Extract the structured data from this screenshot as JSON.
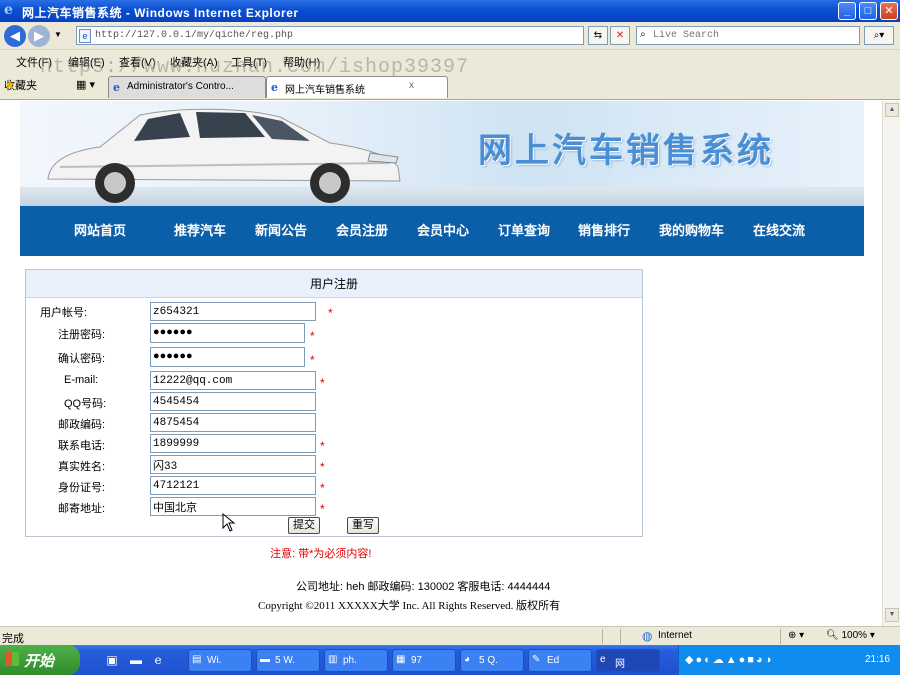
{
  "window": {
    "title": "网上汽车销售系统 - Windows Internet Explorer",
    "minimize": "_",
    "maximize": "□",
    "close": "✕"
  },
  "address": {
    "url": "http://127.0.0.1/my/qiche/reg.php",
    "search_placeholder": "Live Search"
  },
  "menu": [
    "文件(F)",
    "编辑(E)",
    "查看(V)",
    "收藏夹(A)",
    "工具(T)",
    "帮助(H)"
  ],
  "watermark": "https://www.huzhan.com/ishop39397",
  "favorites_label": "收藏夹",
  "tabs": [
    {
      "label": "Administrator's Contro..."
    },
    {
      "label": "网上汽车销售系统"
    }
  ],
  "site": {
    "title": "网上汽车销售系统",
    "nav": [
      "网站首页",
      "推荐汽车",
      "新闻公告",
      "会员注册",
      "会员中心",
      "订单查询",
      "销售排行",
      "我的购物车",
      "在线交流"
    ]
  },
  "form": {
    "heading": "用户注册",
    "fields": [
      {
        "label": "用户帐号:",
        "value": "z654321",
        "required": true
      },
      {
        "label": "注册密码:",
        "value": "●●●●●●",
        "required": true
      },
      {
        "label": "确认密码:",
        "value": "●●●●●●",
        "required": true
      },
      {
        "label": "E-mail:",
        "value": "12222@qq.com",
        "required": true
      },
      {
        "label": "QQ号码:",
        "value": "4545454",
        "required": false
      },
      {
        "label": "邮政编码:",
        "value": "4875454",
        "required": false
      },
      {
        "label": "联系电话:",
        "value": "1899999",
        "required": true
      },
      {
        "label": "真实姓名:",
        "value": "闪33",
        "required": true
      },
      {
        "label": "身份证号:",
        "value": "4712121",
        "required": true
      },
      {
        "label": "邮寄地址:",
        "value": "中国北京",
        "required": true
      }
    ],
    "required_mark": "*",
    "submit": "提交",
    "reset": "重写",
    "notice": "注意: 带*为必须内容!"
  },
  "footer": {
    "address": "公司地址: heh  邮政编码: 130002 客服电话: 4444444",
    "copyright": "Copyright ©2011 XXXXX大学 Inc. All Rights Reserved. 版权所有"
  },
  "status": {
    "left": "完成",
    "zone": "Internet",
    "zoom": "100%"
  },
  "taskbar": {
    "start": "开始",
    "items": [
      "Wi.",
      "5 W.",
      "ph.",
      "97",
      "5 Q.",
      "Ed",
      "网"
    ],
    "clock": "21:16"
  }
}
